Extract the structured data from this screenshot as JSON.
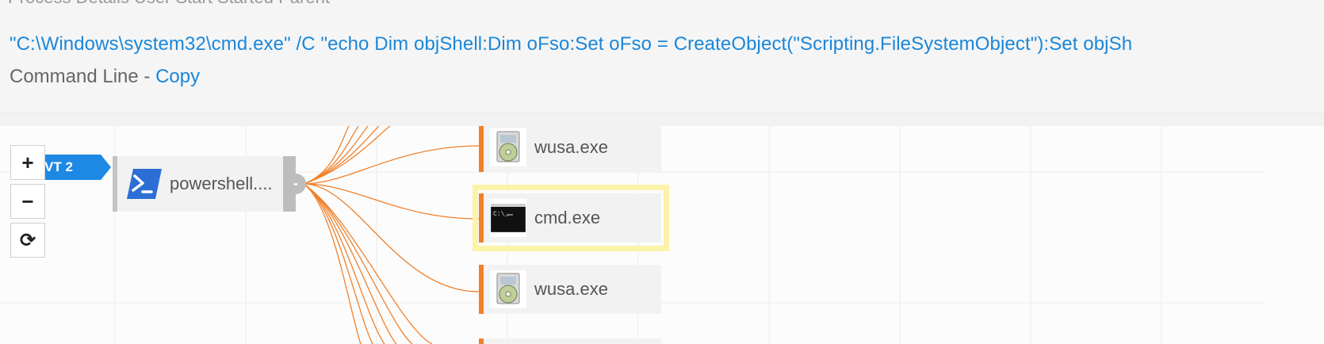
{
  "info": {
    "faded_row": "Process   Details   User   Start   Started   Parent",
    "command_line": "\"C:\\Windows\\system32\\cmd.exe\" /C \"echo Dim objShell:Dim oFso:Set oFso = CreateObject(\"Scripting.FileSystemObject\"):Set objSh",
    "caption_label": "Command Line - ",
    "copy_link": "Copy"
  },
  "graph": {
    "alert_tag": "VT 2",
    "zoom_in": "+",
    "zoom_out": "−",
    "reset": "⟳",
    "parent": {
      "label": "powershell....",
      "icon": "powershell-icon",
      "collapse": "-"
    },
    "children": [
      {
        "label": "wusa.exe",
        "icon": "installer-disc-icon"
      },
      {
        "label": "cmd.exe",
        "icon": "cmd-prompt-icon",
        "selected": true
      },
      {
        "label": "wusa.exe",
        "icon": "installer-disc-icon"
      }
    ],
    "colors": {
      "edge": "#f0812c",
      "accent": "#1e88e5",
      "highlight": "#faf3a8"
    }
  }
}
